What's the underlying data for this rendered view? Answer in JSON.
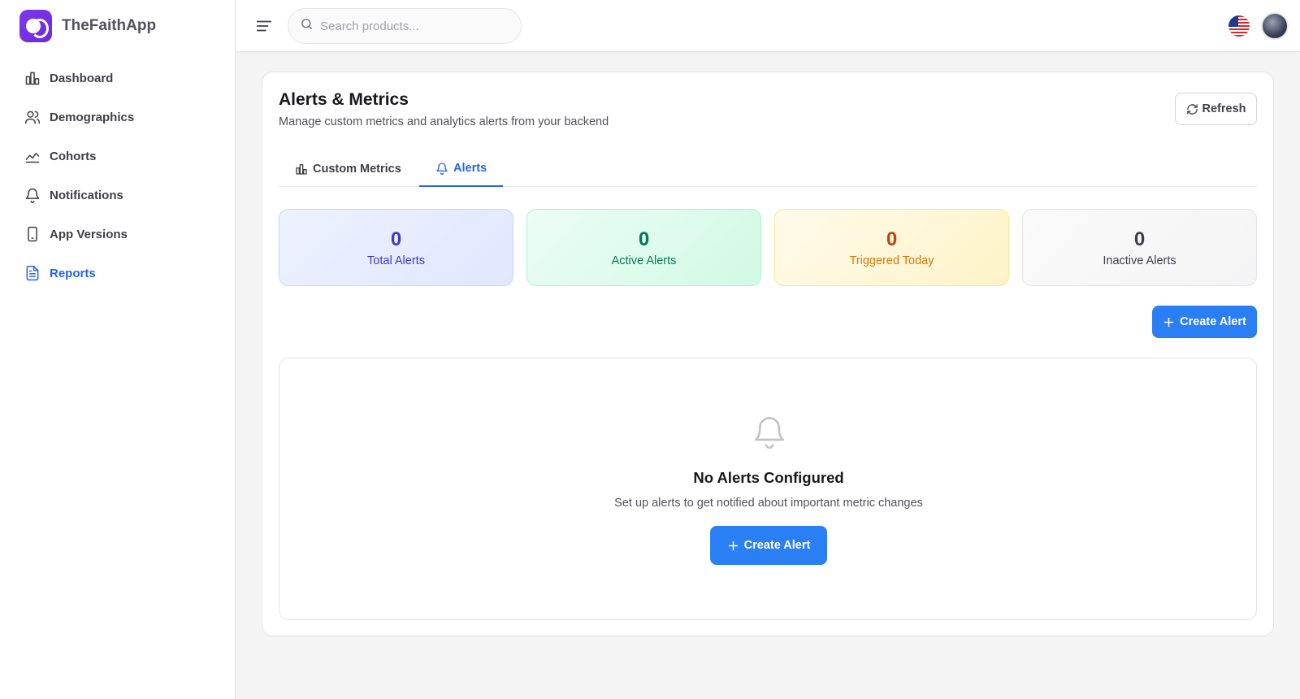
{
  "brand": {
    "name": "TheFaithApp"
  },
  "sidebar": {
    "items": [
      {
        "label": "Dashboard",
        "icon": "bar-chart-icon",
        "active": false
      },
      {
        "label": "Demographics",
        "icon": "users-icon",
        "active": false
      },
      {
        "label": "Cohorts",
        "icon": "trend-line-icon",
        "active": false
      },
      {
        "label": "Notifications",
        "icon": "bell-icon",
        "active": false
      },
      {
        "label": "App Versions",
        "icon": "smartphone-icon",
        "active": false
      },
      {
        "label": "Reports",
        "icon": "document-icon",
        "active": true
      }
    ]
  },
  "topbar": {
    "search_placeholder": "Search products...",
    "language_flag": "us-flag-icon"
  },
  "page": {
    "title": "Alerts & Metrics",
    "subtitle": "Manage custom metrics and analytics alerts from your backend",
    "refresh_label": "Refresh"
  },
  "tabs": [
    {
      "label": "Custom Metrics",
      "icon": "bar-chart-icon",
      "active": false
    },
    {
      "label": "Alerts",
      "icon": "bell-icon",
      "active": true
    }
  ],
  "stats": [
    {
      "value": "0",
      "label": "Total Alerts",
      "color": "#4338ca"
    },
    {
      "value": "0",
      "label": "Active Alerts",
      "color": "#047857"
    },
    {
      "value": "0",
      "label": "Triggered Today",
      "color": "#c2410c"
    },
    {
      "value": "0",
      "label": "Inactive Alerts",
      "color": "#3f3f46"
    }
  ],
  "actions": {
    "create_alert_label": "Create Alert"
  },
  "empty_state": {
    "title": "No Alerts Configured",
    "subtitle": "Set up alerts to get notified about important metric changes",
    "button_label": "Create Alert"
  },
  "colors": {
    "accent": "#2563eb",
    "primary_button": "#2b7ff5",
    "brand": "#7c3aed"
  }
}
